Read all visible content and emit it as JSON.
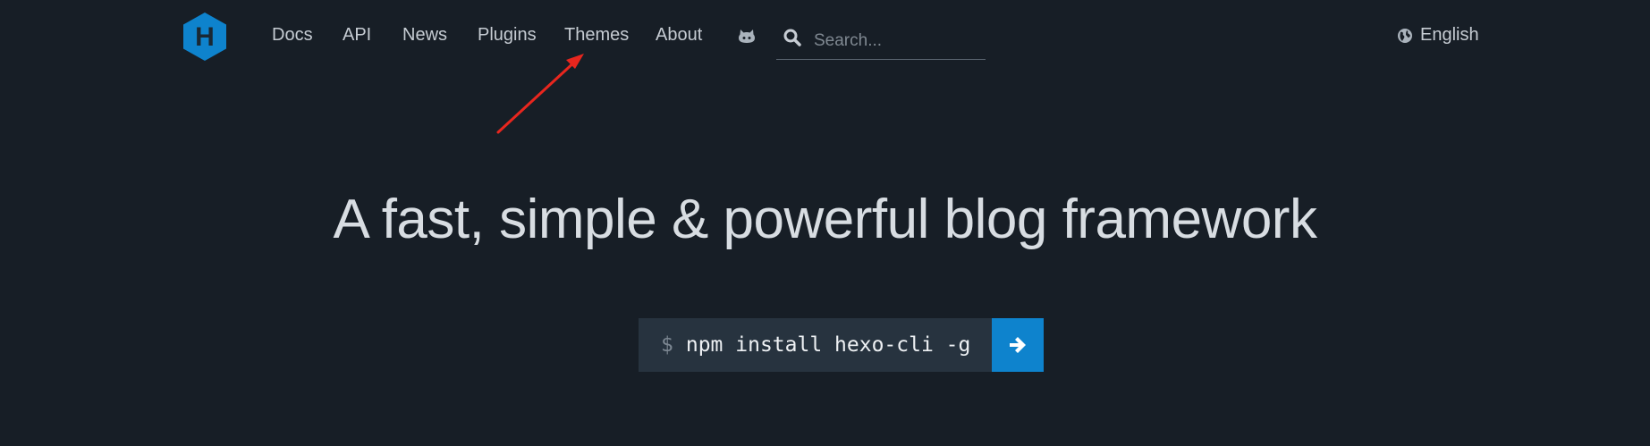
{
  "header": {
    "logo_letter": "H",
    "nav": [
      {
        "label": "Docs"
      },
      {
        "label": "API"
      },
      {
        "label": "News"
      },
      {
        "label": "Plugins"
      },
      {
        "label": "Themes"
      },
      {
        "label": "About"
      }
    ],
    "github_icon": "github-octocat-icon",
    "search": {
      "placeholder": "Search..."
    },
    "language": {
      "label": "English",
      "icon": "globe-icon"
    }
  },
  "hero": {
    "title": "A fast, simple & powerful blog framework",
    "install": {
      "prompt": "$",
      "command": "npm install hexo-cli -g",
      "button_icon": "arrow-right-icon"
    }
  },
  "colors": {
    "background": "#171e26",
    "brand_blue": "#0e83cd",
    "command_bg": "#27333f",
    "annotation_red": "#e8261e"
  }
}
